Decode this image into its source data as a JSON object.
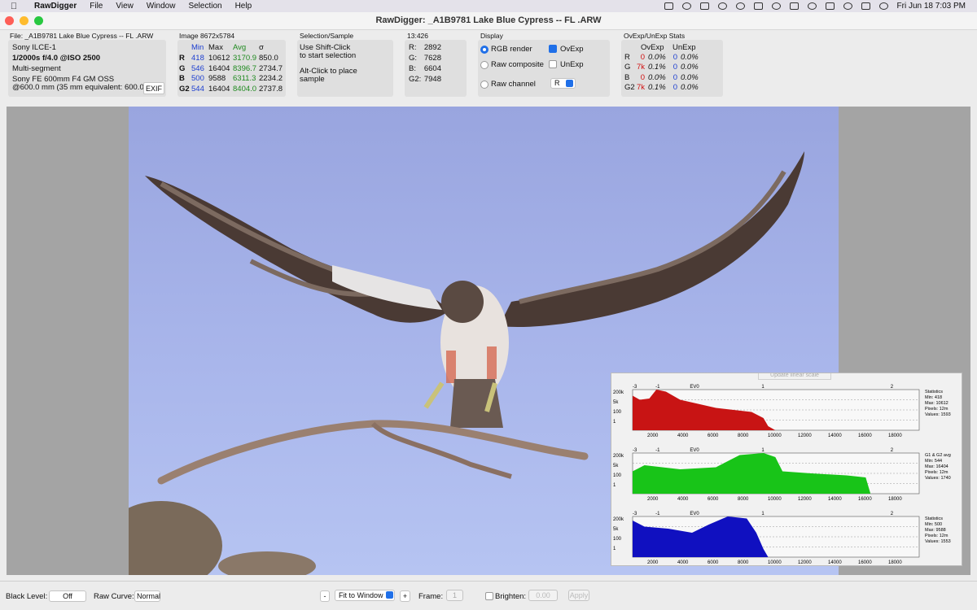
{
  "menubar": {
    "app": "RawDigger",
    "items": [
      "File",
      "View",
      "Window",
      "Selection",
      "Help"
    ],
    "clock": "Fri Jun 18  7:03 PM"
  },
  "window": {
    "title": "RawDigger: _A1B9781 Lake Blue Cypress -- FL .ARW"
  },
  "file_panel": {
    "header": "File: _A1B9781 Lake Blue Cypress -- FL .ARW",
    "camera": "Sony ILCE-1",
    "exposure": "1/2000s f/4.0 @ISO 2500",
    "metering": "Multi-segment",
    "lens": "Sony FE 600mm F4 GM OSS",
    "focal": "@600.0 mm (35 mm equivalent: 600.0 m",
    "exif_label": "EXIF"
  },
  "image_panel": {
    "header": "Image 8672x5784",
    "cols": [
      "Min",
      "Max",
      "Avg",
      "σ"
    ],
    "rows": [
      [
        "R",
        "418",
        "10612",
        "3170.9",
        "850.0"
      ],
      [
        "G",
        "546",
        "16404",
        "8396.7",
        "2734.7"
      ],
      [
        "B",
        "500",
        "9588",
        "6311.3",
        "2234.2"
      ],
      [
        "G2",
        "544",
        "16404",
        "8404.0",
        "2737.8"
      ]
    ]
  },
  "selection_panel": {
    "header": "Selection/Sample",
    "line1": "Use Shift-Click",
    "line2": "to start selection",
    "line3": "Alt-Click to place",
    "line4": "sample"
  },
  "coord_panel": {
    "header": "13:426",
    "rows": [
      [
        "R:",
        "2892"
      ],
      [
        "G:",
        "7628"
      ],
      [
        "B:",
        "6604"
      ],
      [
        "G2:",
        "7948"
      ]
    ]
  },
  "display_panel": {
    "header": "Display",
    "rgb_render": "RGB render",
    "raw_composite": "Raw composite",
    "raw_channel": "Raw channel",
    "ovexp": "OvExp",
    "unexp": "UnExp",
    "channel_value": "R"
  },
  "stats_panel": {
    "header": "OvExp/UnExp Stats",
    "cols": [
      "OvExp",
      "UnExp"
    ],
    "rows": [
      [
        "R",
        "0",
        "0.0%",
        "0",
        "0.0%"
      ],
      [
        "G",
        "7k",
        "0.1%",
        "0",
        "0.0%"
      ],
      [
        "B",
        "0",
        "0.0%",
        "0",
        "0.0%"
      ],
      [
        "G2",
        "7k",
        "0.1%",
        "0",
        "0.0%"
      ]
    ]
  },
  "histogram": {
    "top_button": "Update linear scale",
    "x_ticks": [
      "2000",
      "4000",
      "6000",
      "8000",
      "10000",
      "12000",
      "14000",
      "16000",
      "18000"
    ],
    "y_ticks": [
      "200k",
      "5k",
      "100",
      "1"
    ],
    "ev_ticks": [
      "-3",
      "-1",
      "EV0",
      "1",
      "2"
    ],
    "panels": [
      {
        "color": "#c81414",
        "stats": [
          "Statistics",
          "Min: 418",
          "Max: 10612",
          "Pixels: 12m",
          "Values: 1593"
        ]
      },
      {
        "color": "#18c418",
        "stats": [
          "G1 & G2 avg",
          "Min: 544",
          "Max: 16404",
          "Pixels: 12m",
          "Values: 1740"
        ]
      },
      {
        "color": "#1010c0",
        "stats": [
          "Statistics",
          "Min: 500",
          "Max: 9588",
          "Pixels: 12m",
          "Values: 1553"
        ]
      }
    ]
  },
  "bottom": {
    "black_level_label": "Black Level:",
    "black_level_value": "Off",
    "raw_curve_label": "Raw Curve:",
    "raw_curve_value": "Normal",
    "minus": "-",
    "zoom": "Fit to Window",
    "plus": "+",
    "frame_label": "Frame:",
    "frame_value": "1",
    "brighten_label": "Brighten:",
    "brighten_value": "0.00",
    "apply": "Apply"
  }
}
